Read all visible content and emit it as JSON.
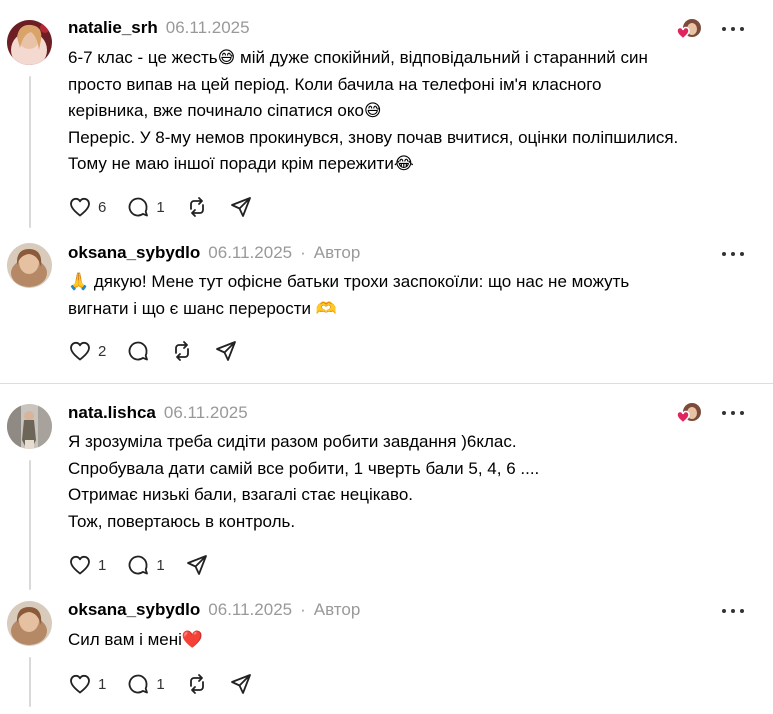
{
  "posts": [
    {
      "username": "natalie_srh",
      "date": "06.11.2025",
      "author_badge": "",
      "lines": [
        "6-7 клас - це жесть😅 мій дуже спокійний, відповідальний і старанний син",
        "просто випав на цей період. Коли бачила на телефоні ім'я класного",
        "керівника, вже починало сіпатися око😅",
        "Перерiс. У 8-му немов прокинувся, знову почав вчитися, оцінки поліпшилися.",
        "Тому не маю іншої поради крім пережити😂"
      ],
      "likes": "6",
      "replies": "1",
      "reposts": "",
      "liked_by_author": true
    },
    {
      "username": "oksana_sybydlo",
      "date": "06.11.2025",
      "separator": "·",
      "author_badge": "Автор",
      "lines": [
        "🙏 дякую! Мене тут офісне батьки трохи заспокоїли: що нас не можуть",
        "вигнати і що є шанс перерости 🫶"
      ],
      "likes": "2",
      "replies": "",
      "reposts": "",
      "liked_by_author": false
    },
    {
      "username": "nata.lishca",
      "date": "06.11.2025",
      "author_badge": "",
      "lines": [
        "Я зрозуміла треба сидіти разом робити завдання )6клас.",
        "Спробувала дати самій все робити, 1 чверть бали 5, 4, 6 ....",
        "Отримає низькі бали, взагалі стає нецікаво.",
        "Тож, повертаюсь в контроль."
      ],
      "likes": "1",
      "replies": "1",
      "reposts": "",
      "liked_by_author": true
    },
    {
      "username": "oksana_sybydlo",
      "date": "06.11.2025",
      "separator": "·",
      "author_badge": "Автор",
      "lines": [
        "Сил вам і мені❤️"
      ],
      "likes": "1",
      "replies": "1",
      "reposts": "",
      "liked_by_author": false
    }
  ],
  "icons": {
    "more": "more-options-icon",
    "like": "heart-icon",
    "reply": "comment-icon",
    "repost": "repost-icon",
    "share": "share-icon"
  },
  "colors": {
    "like_heart": "#e0245e",
    "muted_text": "#999999",
    "thread_line": "#d9d9d9"
  }
}
